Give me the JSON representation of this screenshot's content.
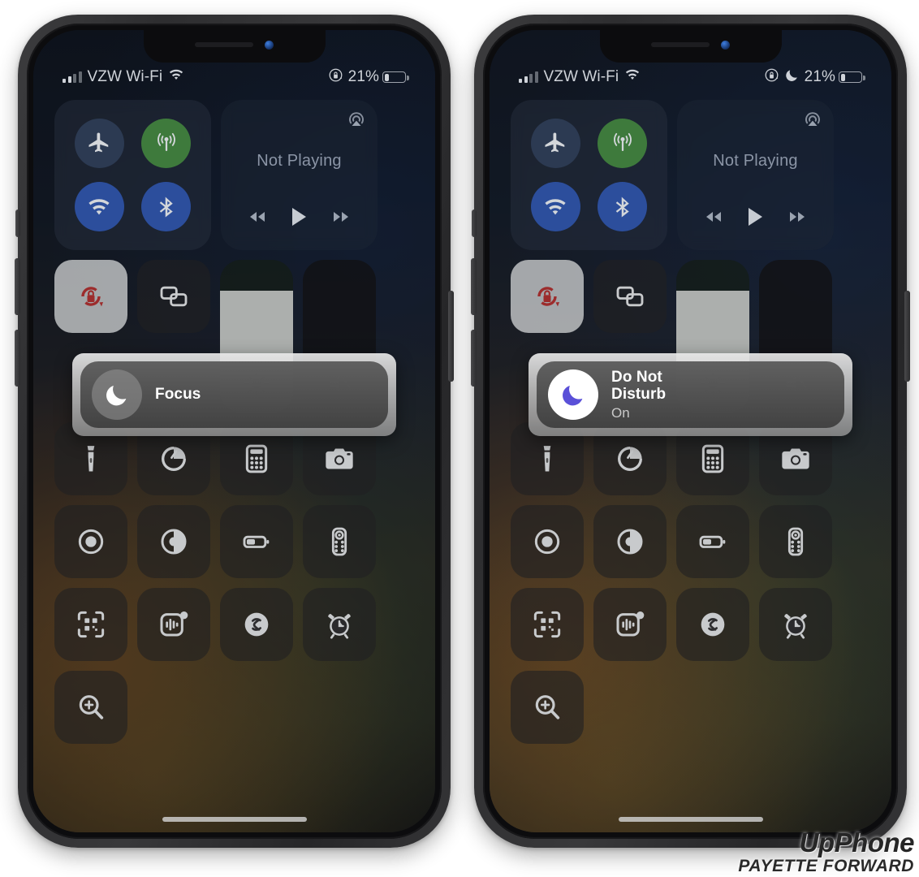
{
  "watermark": {
    "brand": "UpPhone",
    "publisher": "PAYETTE FORWARD"
  },
  "phones": [
    {
      "id": "left",
      "status_bar": {
        "carrier": "VZW Wi-Fi",
        "battery_percent": "21%",
        "icons": [
          "signal-bars-icon",
          "wifi-icon",
          "rotation-lock-icon",
          "battery-icon"
        ],
        "dnd_icon_visible": false
      },
      "connectivity": {
        "airplane": {
          "name": "airplane-mode-toggle",
          "state": "off",
          "color": "#2c3a52"
        },
        "cellular": {
          "name": "cellular-data-toggle",
          "state": "on",
          "color": "#3e7a3c"
        },
        "wifi": {
          "name": "wifi-toggle",
          "state": "on",
          "color": "#2c4e9c"
        },
        "bluetooth": {
          "name": "bluetooth-toggle",
          "state": "on",
          "color": "#2c4e9c"
        }
      },
      "media": {
        "title": "Not Playing",
        "airplay": "airplay-icon",
        "controls": [
          "rewind-button",
          "play-button",
          "fast-forward-button"
        ]
      },
      "rotation_lock": {
        "label": "rotation-lock",
        "state": "on"
      },
      "screen_mirroring": {
        "label": "screen-mirroring",
        "state": "off"
      },
      "brightness": {
        "label": "brightness-slider",
        "value": 80
      },
      "volume": {
        "label": "volume-slider",
        "value": 2,
        "muted": true
      },
      "focus_tile": {
        "title": "Focus",
        "subtitle": "",
        "state": "off",
        "icon": "crescent-moon-icon",
        "icon_color": "#ffffff",
        "circle_color": "#969696"
      },
      "shortcuts": [
        [
          "flashlight-icon",
          "timer-icon",
          "calculator-icon",
          "camera-icon"
        ],
        [
          "screen-record-icon",
          "dark-mode-icon",
          "low-power-mode-icon",
          "apple-tv-remote-icon"
        ],
        [
          "qr-code-scanner-icon",
          "voice-memos-icon",
          "shazam-icon",
          "alarm-clock-icon"
        ],
        [
          "magnifier-icon"
        ]
      ]
    },
    {
      "id": "right",
      "status_bar": {
        "carrier": "VZW Wi-Fi",
        "battery_percent": "21%",
        "icons": [
          "signal-bars-icon",
          "wifi-icon",
          "rotation-lock-icon",
          "do-not-disturb-moon-icon",
          "battery-icon"
        ],
        "dnd_icon_visible": true
      },
      "connectivity": {
        "airplane": {
          "name": "airplane-mode-toggle",
          "state": "off",
          "color": "#2c3a52"
        },
        "cellular": {
          "name": "cellular-data-toggle",
          "state": "on",
          "color": "#3e7a3c"
        },
        "wifi": {
          "name": "wifi-toggle",
          "state": "on",
          "color": "#2c4e9c"
        },
        "bluetooth": {
          "name": "bluetooth-toggle",
          "state": "on",
          "color": "#2c4e9c"
        }
      },
      "media": {
        "title": "Not Playing",
        "airplay": "airplay-icon",
        "controls": [
          "rewind-button",
          "play-button",
          "fast-forward-button"
        ]
      },
      "rotation_lock": {
        "label": "rotation-lock",
        "state": "on"
      },
      "screen_mirroring": {
        "label": "screen-mirroring",
        "state": "off"
      },
      "brightness": {
        "label": "brightness-slider",
        "value": 80
      },
      "volume": {
        "label": "volume-slider",
        "value": 2,
        "muted": true
      },
      "focus_tile": {
        "title": "Do Not\nDisturb",
        "title_line1": "Do Not",
        "title_line2": "Disturb",
        "subtitle": "On",
        "state": "on",
        "icon": "crescent-moon-icon",
        "icon_color": "#5a50d8",
        "circle_color": "#ffffff"
      },
      "shortcuts": [
        [
          "flashlight-icon",
          "timer-icon",
          "calculator-icon",
          "camera-icon"
        ],
        [
          "screen-record-icon",
          "dark-mode-icon",
          "low-power-mode-icon",
          "apple-tv-remote-icon"
        ],
        [
          "qr-code-scanner-icon",
          "voice-memos-icon",
          "shazam-icon",
          "alarm-clock-icon"
        ],
        [
          "magnifier-icon"
        ]
      ]
    }
  ]
}
